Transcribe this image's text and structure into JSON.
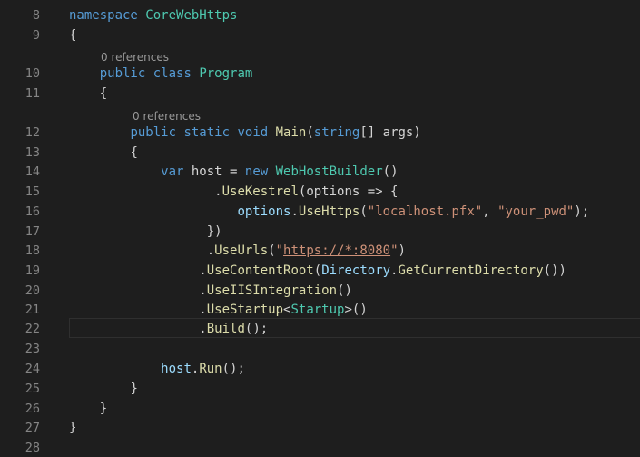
{
  "colors": {
    "background": "#1e1e1e",
    "line_number": "#858585",
    "keyword": "#569cd6",
    "type": "#4ec9b0",
    "function": "#dcdcaa",
    "variable": "#9cdcfe",
    "string": "#ce9178",
    "plain": "#d4d4d4",
    "codelens": "#999999"
  },
  "line_numbers": [
    "8",
    "9",
    "10",
    "11",
    "12",
    "13",
    "14",
    "15",
    "16",
    "17",
    "18",
    "19",
    "20",
    "21",
    "22",
    "23",
    "24",
    "25",
    "26",
    "27",
    "28"
  ],
  "codelens": {
    "class_refs": "0 references",
    "method_refs": "0 references"
  },
  "code": {
    "namespace_kw": "namespace",
    "namespace_name": "CoreWebHttps",
    "open_brace": "{",
    "close_brace": "}",
    "public_kw": "public",
    "class_kw": "class",
    "class_name": "Program",
    "static_kw": "static",
    "void_kw": "void",
    "main_name": "Main",
    "string_kw": "string",
    "args_rest": "[] args)",
    "open_paren": "(",
    "var_kw": "var",
    "host_assign": " host = ",
    "new_kw": "new",
    "webhostbuilder": "WebHostBuilder",
    "empty_parens": "()",
    "dot": ".",
    "use_kestrel": "UseKestrel",
    "kestrel_args": "(options => {",
    "options_var": "options",
    "use_https": "UseHttps",
    "str_pfx": "\"localhost.pfx\"",
    "comma": ", ",
    "str_pwd": "\"your_pwd\"",
    "close_paren_semicolon": ");",
    "close_lambda": "})",
    "use_urls": "UseUrls",
    "url_open_quote": "\"",
    "url_value": "https://*:8080",
    "url_close_quote": "\"",
    "close_paren": ")",
    "use_content_root": "UseContentRoot",
    "directory_type": "Directory",
    "get_current_directory": "GetCurrentDirectory",
    "double_close_paren": "())",
    "use_iis": "UseIISIntegration",
    "use_startup": "UseStartup",
    "lt": "<",
    "startup_type": "Startup",
    "gt_parens": ">()",
    "build": "Build",
    "parens_semicolon": "();",
    "host_var": "host",
    "run": "Run"
  }
}
